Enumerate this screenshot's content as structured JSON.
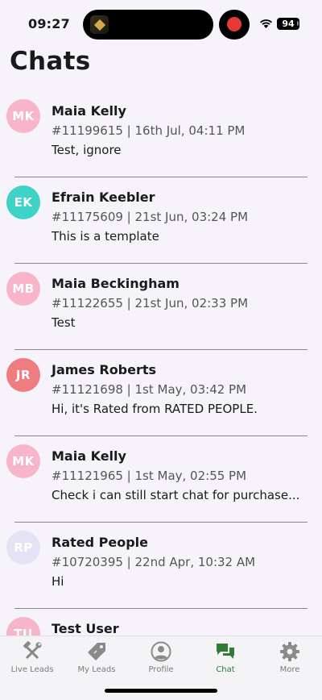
{
  "status_bar": {
    "time": "09:27",
    "battery": "94"
  },
  "page_title": "Chats",
  "chats": [
    {
      "initials": "MK",
      "name": "Maia Kelly",
      "meta": "#11199615 | 16th Jul, 04:11 PM",
      "preview": "Test, ignore",
      "avatar_color": "#f8b4c8"
    },
    {
      "initials": "EK",
      "name": "Efrain Keebler",
      "meta": "#11175609 | 21st Jun, 03:24 PM",
      "preview": "This is a template",
      "avatar_color": "#3fd3c8"
    },
    {
      "initials": "MB",
      "name": "Maia Beckingham",
      "meta": "#11122655 | 21st Jun, 02:33 PM",
      "preview": "Test",
      "avatar_color": "#f8b4c8"
    },
    {
      "initials": "JR",
      "name": "James Roberts",
      "meta": "#11121698 | 1st May, 03:42 PM",
      "preview": "Hi, it's Rated from RATED PEOPLE.",
      "avatar_color": "#ef7d80"
    },
    {
      "initials": "MK",
      "name": "Maia Kelly",
      "meta": "#11121965 | 1st May, 02:55 PM",
      "preview": "Check i can still start chat for purchase...",
      "avatar_color": "#f8b4c8"
    },
    {
      "initials": "RP",
      "name": "Rated People",
      "meta": "#10720395 | 22nd Apr, 10:32 AM",
      "preview": "Hi",
      "avatar_color": "#e6e2f6"
    },
    {
      "initials": "TU",
      "name": "Test User",
      "meta": "",
      "preview": "",
      "avatar_color": "#f8b4c8"
    }
  ],
  "tabs": [
    {
      "label": "Live Leads",
      "icon": "hammer-wrench-icon",
      "active": false
    },
    {
      "label": "My Leads",
      "icon": "price-tag-icon",
      "active": false
    },
    {
      "label": "Profile",
      "icon": "profile-icon",
      "active": false
    },
    {
      "label": "Chat",
      "icon": "chat-bubbles-icon",
      "active": true
    },
    {
      "label": "More",
      "icon": "gear-icon",
      "active": false
    }
  ],
  "colors": {
    "active_tab": "#2e7d32",
    "inactive_tab": "#8a8a8a"
  }
}
